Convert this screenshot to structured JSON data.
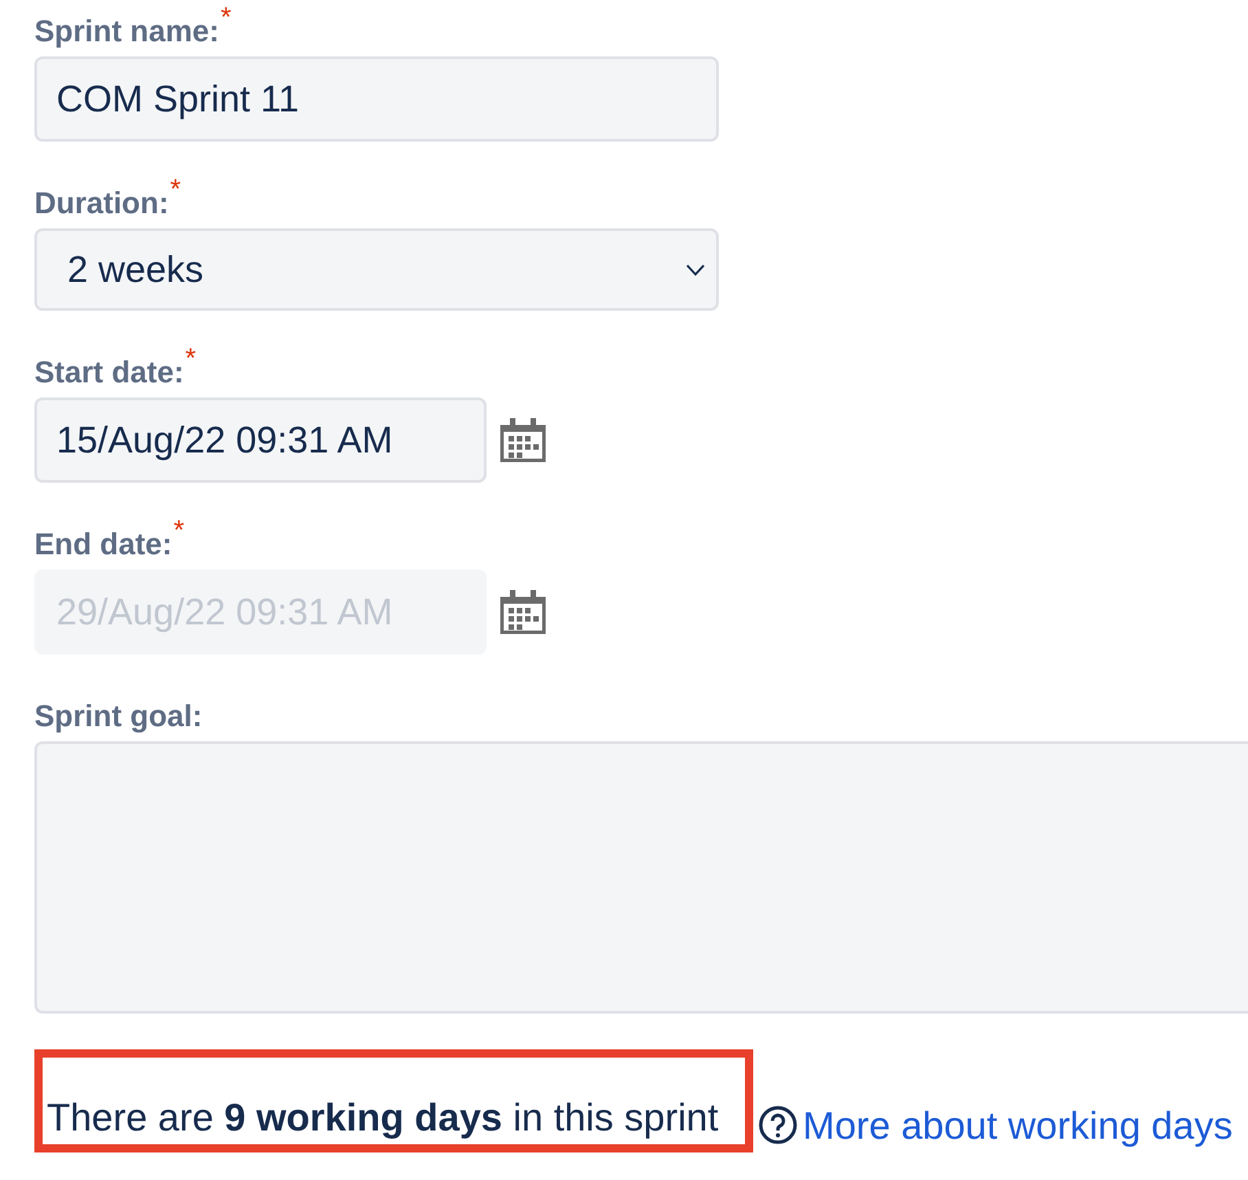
{
  "form": {
    "fields": [
      {
        "kind": "text",
        "label": "Sprint name:",
        "required_mark": "*",
        "value": "COM Sprint 11",
        "disabled": false
      },
      {
        "kind": "select",
        "label": "Duration:",
        "required_mark": "*",
        "value": "2 weeks",
        "disabled": false
      },
      {
        "kind": "date",
        "label": "Start date:",
        "required_mark": "*",
        "value": "15/Aug/22 09:31 AM",
        "disabled": false
      },
      {
        "kind": "date",
        "label": "End date:",
        "required_mark": "*",
        "value": "29/Aug/22 09:31 AM",
        "disabled": true
      },
      {
        "kind": "textarea",
        "label": "Sprint goal:",
        "disabled": false
      }
    ]
  },
  "working_days": {
    "text": "There are **9 working days** in this sprint",
    "highlighted": true
  },
  "help_link": {
    "label": "More about working days"
  }
}
